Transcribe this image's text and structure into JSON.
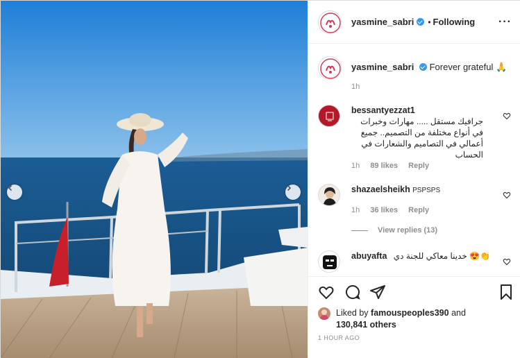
{
  "post": {
    "header": {
      "username": "yasmine_sabri",
      "separator": "•",
      "follow_status": "Following",
      "more_icon": "more-horizontal-icon"
    },
    "caption": {
      "username": "yasmine_sabri",
      "text": "Forever grateful",
      "emoji": "🙏",
      "time": "1h"
    },
    "comments": [
      {
        "username": "bessantyezzat1",
        "text_rtl": "جرافيك مستقل ..... مهارات وخبرات في أنواع مختلفة من التصميم.. جميع أعمالي في التصاميم والشعارات في الحساب",
        "time": "1h",
        "likes": "89 likes",
        "reply": "Reply"
      },
      {
        "username": "shazaelsheikh",
        "text": "PSPSPS",
        "time": "1h",
        "likes": "36 likes",
        "reply": "Reply",
        "view_replies": "View replies (13)"
      },
      {
        "username": "abuyafta",
        "text_rtl": "خدينا معاكي للجنة دي 😍👏"
      }
    ],
    "liked_by": {
      "prefix": "Liked by",
      "user": "famouspeoples390",
      "and": "and",
      "count": "130,841 others"
    },
    "posted_time": "1 HOUR AGO"
  },
  "icons": {
    "like": "heart-icon",
    "comment": "comment-icon",
    "share": "paper-plane-icon",
    "save": "bookmark-icon",
    "prev": "chevron-left-icon",
    "next": "chevron-right-icon"
  },
  "colors": {
    "verified": "#3897f0",
    "text": "#262626",
    "muted": "#8e8e8e",
    "border": "#efefef"
  }
}
